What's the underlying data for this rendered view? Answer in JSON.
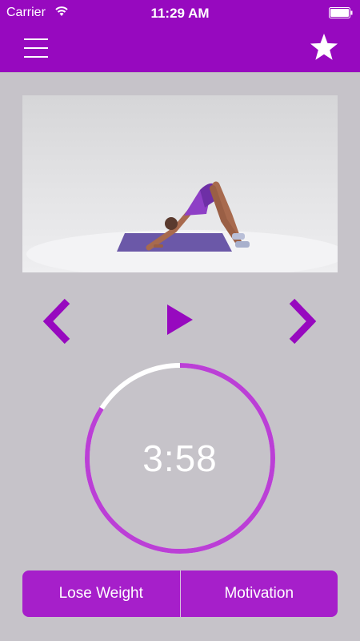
{
  "status": {
    "carrier": "Carrier",
    "time": "11:29 AM",
    "icons": [
      "wifi-icon",
      "battery-icon"
    ]
  },
  "navbar": {
    "menu_icon": "hamburger-menu-icon",
    "favorite_icon": "star-icon"
  },
  "player": {
    "prev_icon": "chevron-left-icon",
    "play_icon": "play-icon",
    "next_icon": "chevron-right-icon"
  },
  "timer": {
    "display": "3:58",
    "progress_fraction": 0.84
  },
  "bottom": {
    "left_label": "Lose Weight",
    "right_label": "Motivation"
  },
  "colors": {
    "accent": "#9709bf",
    "button": "#a61fca",
    "ring": "#bb3fd6",
    "background": "#c6c3c9"
  }
}
